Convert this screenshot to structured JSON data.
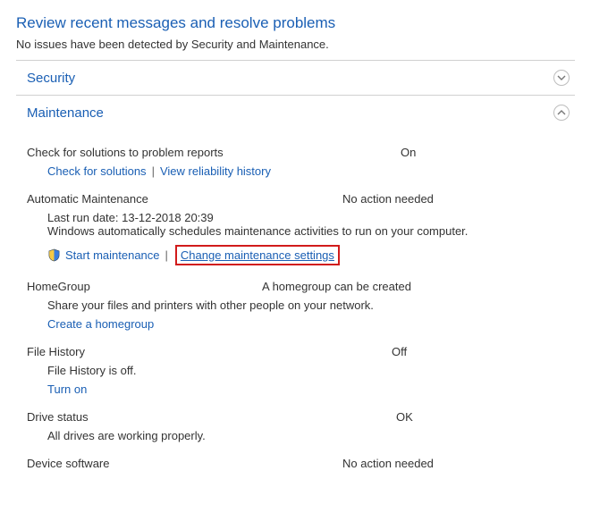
{
  "header": {
    "title": "Review recent messages and resolve problems",
    "subtitle": "No issues have been detected by Security and Maintenance."
  },
  "sections": {
    "security": {
      "label": "Security"
    },
    "maintenance": {
      "label": "Maintenance"
    }
  },
  "problem_reports": {
    "label": "Check for solutions to problem reports",
    "status": "On",
    "check_link": "Check for solutions",
    "reliability_link": "View reliability history"
  },
  "auto_maint": {
    "label": "Automatic Maintenance",
    "status": "No action needed",
    "last_run": "Last run date: 13-12-2018 20:39",
    "desc": "Windows automatically schedules maintenance activities to run on your computer.",
    "start_link": "Start maintenance",
    "change_link": "Change maintenance settings"
  },
  "homegroup": {
    "label": "HomeGroup",
    "status": "A homegroup can be created",
    "desc": "Share your files and printers with other people on your network.",
    "create_link": "Create a homegroup"
  },
  "file_history": {
    "label": "File History",
    "status": "Off",
    "desc": "File History is off.",
    "turn_on_link": "Turn on"
  },
  "drive_status": {
    "label": "Drive status",
    "status": "OK",
    "desc": "All drives are working properly."
  },
  "device_software": {
    "label": "Device software",
    "status": "No action needed"
  }
}
